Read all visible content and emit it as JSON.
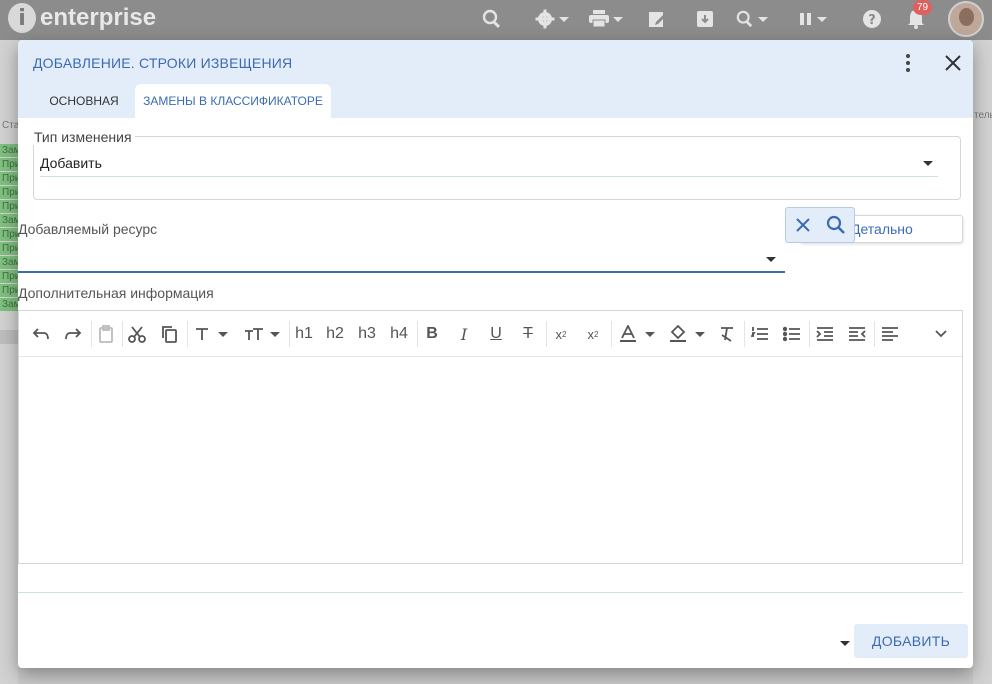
{
  "app": {
    "logo_text": "enterprise",
    "notifications_count": "79"
  },
  "background": {
    "left_header": "Ста",
    "left_cells": [
      "Зам",
      "При",
      "При",
      "При",
      "При",
      "Зам",
      "При",
      "При",
      "Зам",
      "При",
      "При",
      "Зам"
    ],
    "right_header": "тель"
  },
  "dialog": {
    "title": "ДОБАВЛЕНИЕ. СТРОКИ ИЗВЕЩЕНИЯ",
    "tabs": [
      {
        "label": "ОСНОВНАЯ"
      },
      {
        "label": "ЗАМЕНЫ В КЛАССИФИКАТОРЕ"
      }
    ],
    "change_type": {
      "legend": "Тип изменения",
      "value": "Добавить"
    },
    "resource": {
      "label": "Добавляемый ресурс",
      "value": "",
      "detail_label": "Детально"
    },
    "extra_info": {
      "label": "Дополнительная информация",
      "content": ""
    },
    "toolbar": {
      "h1": "h1",
      "h2": "h2",
      "h3": "h3",
      "h4": "h4",
      "bold": "B",
      "italic": "I",
      "underline": "U",
      "strike": "T",
      "sub": "x",
      "sup": "x"
    },
    "add_button": "ДОБАВИТЬ"
  },
  "colors": {
    "accent": "#3b6bb5",
    "header_bg": "#e3ecf9",
    "appbar": "#8c8c8c"
  }
}
